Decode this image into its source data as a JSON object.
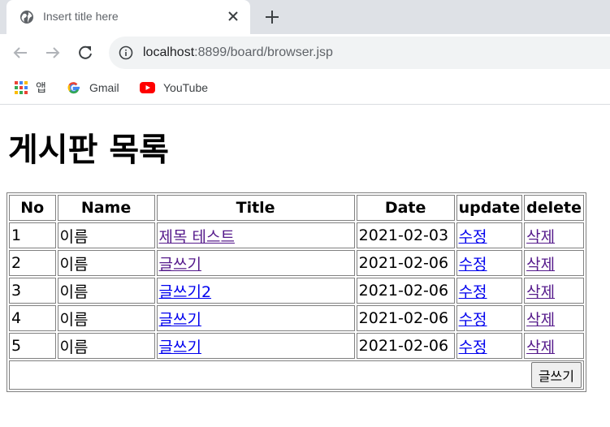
{
  "browser": {
    "tab_title": "Insert title here",
    "url_host": "localhost",
    "url_path": ":8899/board/browser.jsp",
    "bookmarks": [
      {
        "label": "앱",
        "icon": "apps-grid-icon"
      },
      {
        "label": "Gmail",
        "icon": "google-g-icon"
      },
      {
        "label": "YouTube",
        "icon": "youtube-icon"
      }
    ]
  },
  "page": {
    "heading": "게시판 목록",
    "columns": [
      "No",
      "Name",
      "Title",
      "Date",
      "update",
      "delete"
    ],
    "rows": [
      {
        "no": "1",
        "name": "이름",
        "title": "제목 테스트",
        "date": "2021-02-03",
        "update": "수정",
        "delete": "삭제"
      },
      {
        "no": "2",
        "name": "이름",
        "title": "글쓰기",
        "date": "2021-02-06",
        "update": "수정",
        "delete": "삭제"
      },
      {
        "no": "3",
        "name": "이름",
        "title": "글쓰기2",
        "date": "2021-02-06",
        "update": "수정",
        "delete": "삭제"
      },
      {
        "no": "4",
        "name": "이름",
        "title": "글쓰기",
        "date": "2021-02-06",
        "update": "수정",
        "delete": "삭제"
      },
      {
        "no": "5",
        "name": "이름",
        "title": "글쓰기",
        "date": "2021-02-06",
        "update": "수정",
        "delete": "삭제"
      }
    ],
    "write_button": "글쓰기"
  },
  "colors": {
    "link_visited": "#551a8b",
    "link_unvisited": "#0000ee",
    "tabstrip_bg": "#dee1e6",
    "omnibox_bg": "#f1f3f4"
  }
}
